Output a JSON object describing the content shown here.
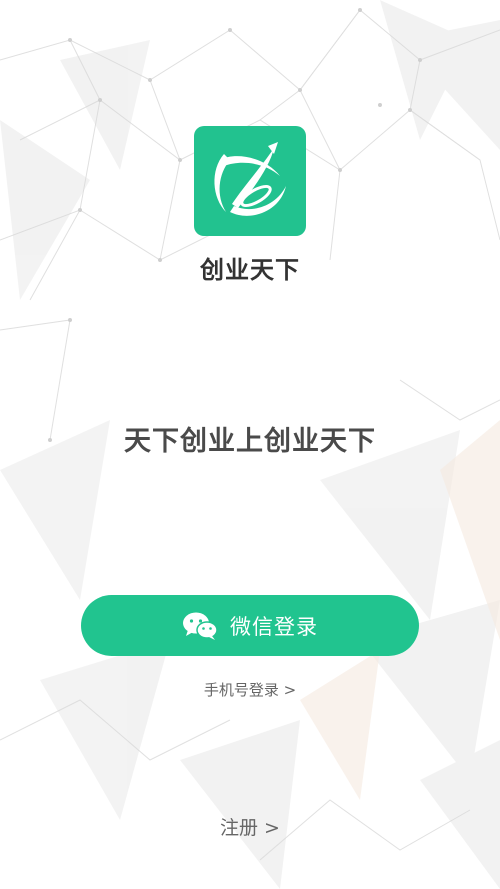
{
  "app": {
    "name": "创业天下",
    "slogan": "天下创业上创业天下"
  },
  "actions": {
    "wechat_login_label": "微信登录",
    "phone_login_label": "手机号登录 >",
    "register_label": "注册 >"
  },
  "icons": {
    "logo": "app-logo-icon",
    "wechat": "wechat-icon"
  },
  "colors": {
    "brand_green": "#21c48f",
    "text_dark": "#333333",
    "text_muted": "#666666"
  }
}
